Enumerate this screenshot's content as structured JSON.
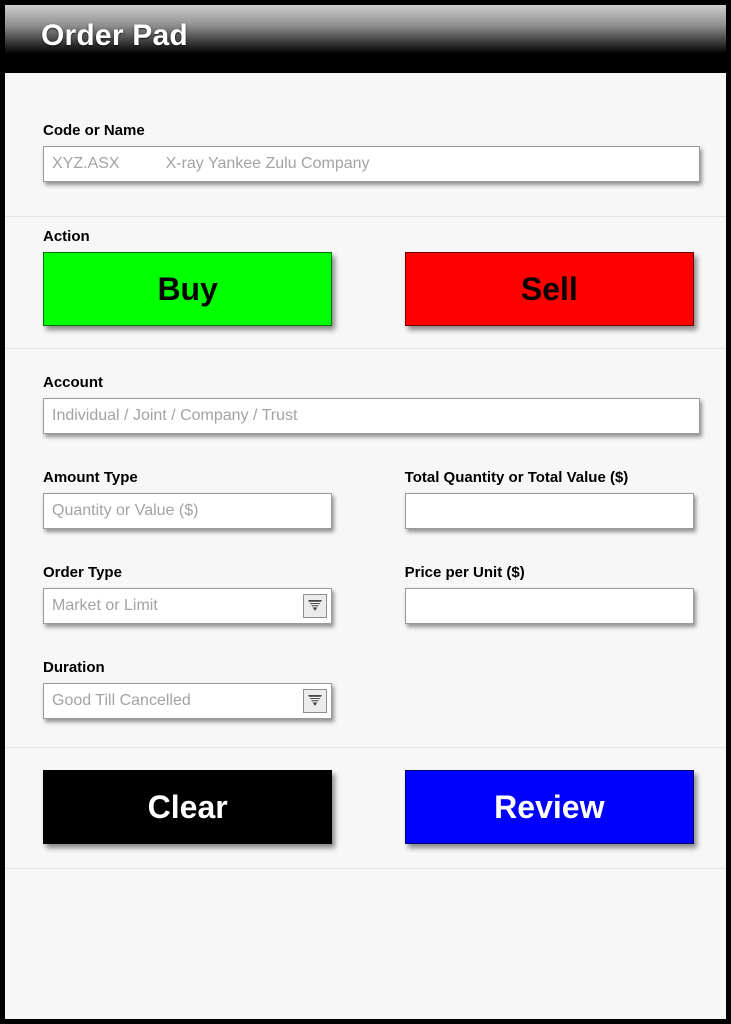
{
  "header": {
    "title": "Order Pad"
  },
  "form": {
    "code_or_name": {
      "label": "Code or Name",
      "placeholder_code": "XYZ.ASX",
      "placeholder_name": "X-ray Yankee Zulu Company",
      "value": ""
    },
    "action": {
      "label": "Action",
      "buy_label": "Buy",
      "sell_label": "Sell",
      "buy_color": "#00ff00",
      "sell_color": "#ff0000",
      "buy_text_color": "#000000",
      "sell_text_color": "#000000"
    },
    "account": {
      "label": "Account",
      "placeholder": "Individual / Joint / Company / Trust",
      "value": ""
    },
    "amount_type": {
      "label": "Amount Type",
      "placeholder": "Quantity or Value ($)",
      "value": ""
    },
    "total_quantity_or_value": {
      "label": "Total Quantity or Total Value ($)",
      "placeholder": "",
      "value": ""
    },
    "order_type": {
      "label": "Order Type",
      "placeholder": "Market or Limit",
      "value": "",
      "dropdown_icon": "chevron-down-icon"
    },
    "price_per_unit": {
      "label": "Price per Unit ($)",
      "placeholder": "",
      "value": ""
    },
    "duration": {
      "label": "Duration",
      "placeholder": "Good Till Cancelled",
      "value": "",
      "dropdown_icon": "chevron-down-icon"
    }
  },
  "footer": {
    "clear_label": "Clear",
    "review_label": "Review",
    "clear_color": "#000000",
    "review_color": "#0000ff",
    "clear_text_color": "#ffffff",
    "review_text_color": "#ffffff"
  }
}
